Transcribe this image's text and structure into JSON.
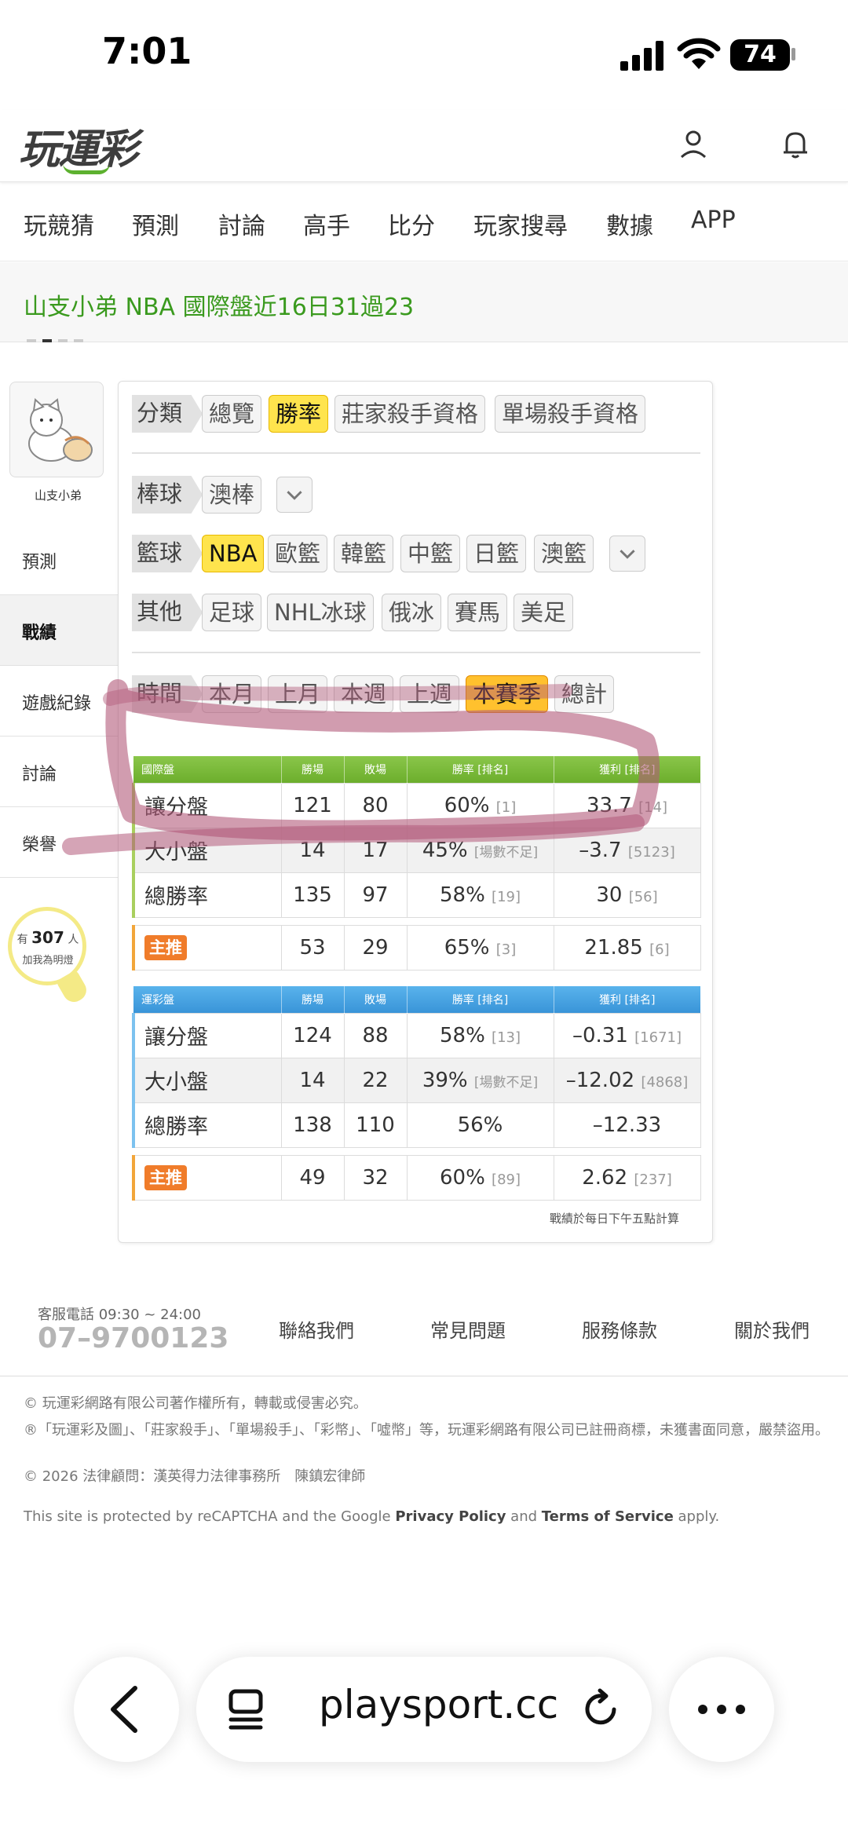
{
  "status_bar": {
    "time": "7:01",
    "battery": "74"
  },
  "header": {
    "logo": "玩運彩"
  },
  "nav": {
    "items": [
      "玩競猜",
      "預測",
      "討論",
      "高手",
      "比分",
      "玩家搜尋",
      "數據",
      "APP"
    ]
  },
  "banner": {
    "title": "山支小弟 NBA 國際盤近16日31過23"
  },
  "sidebar": {
    "profile_name": "山支小弟",
    "items": [
      "預測",
      "戰績",
      "遊戲紀錄",
      "討論",
      "榮譽"
    ],
    "active": "戰績",
    "follower_prefix": "有",
    "follower_count": "307",
    "follower_unit": "人",
    "follower_cta": "加我為明燈"
  },
  "filters": {
    "category_label": "分類",
    "categories": [
      "總覽",
      "勝率",
      "莊家殺手資格",
      "單場殺手資格"
    ],
    "baseball_label": "棒球",
    "baseball": [
      "澳棒"
    ],
    "basketball_label": "籃球",
    "basketball": [
      "NBA",
      "歐籃",
      "韓籃",
      "中籃",
      "日籃",
      "澳籃"
    ],
    "other_label": "其他",
    "other": [
      "足球",
      "NHL冰球",
      "俄冰",
      "賽馬",
      "美足"
    ],
    "time_label": "時間",
    "time": [
      "本月",
      "上月",
      "本週",
      "上週",
      "本賽季",
      "總計"
    ]
  },
  "international_table": {
    "headers": [
      "國際盤",
      "勝場",
      "敗場",
      "勝率 [排名]",
      "獲利 [排名]"
    ],
    "rows": [
      {
        "label": "讓分盤",
        "win": "121",
        "lose": "80",
        "rate": "60%",
        "rate_rank": "[1]",
        "profit": "33.7",
        "profit_rank": "[14]"
      },
      {
        "label": "大小盤",
        "win": "14",
        "lose": "17",
        "rate": "45%",
        "rate_rank": "[場數不足]",
        "profit": "–3.7",
        "profit_rank": "[5123]"
      },
      {
        "label": "總勝率",
        "win": "135",
        "lose": "97",
        "rate": "58%",
        "rate_rank": "[19]",
        "profit": "30",
        "profit_rank": "[56]"
      }
    ],
    "star": {
      "label": "主推",
      "win": "53",
      "lose": "29",
      "rate": "65%",
      "rate_rank": "[3]",
      "profit": "21.85",
      "profit_rank": "[6]"
    }
  },
  "lottery_table": {
    "headers": [
      "運彩盤",
      "勝場",
      "敗場",
      "勝率 [排名]",
      "獲利 [排名]"
    ],
    "rows": [
      {
        "label": "讓分盤",
        "win": "124",
        "lose": "88",
        "rate": "58%",
        "rate_rank": "[13]",
        "profit": "–0.31",
        "profit_rank": "[1671]"
      },
      {
        "label": "大小盤",
        "win": "14",
        "lose": "22",
        "rate": "39%",
        "rate_rank": "[場數不足]",
        "profit": "–12.02",
        "profit_rank": "[4868]"
      },
      {
        "label": "總勝率",
        "win": "138",
        "lose": "110",
        "rate": "56%",
        "rate_rank": "",
        "profit": "–12.33",
        "profit_rank": ""
      }
    ],
    "star": {
      "label": "主推",
      "win": "49",
      "lose": "32",
      "rate": "60%",
      "rate_rank": "[89]",
      "profit": "2.62",
      "profit_rank": "[237]"
    }
  },
  "calc_note": "戰績於每日下午五點計算",
  "footer": {
    "phone_label": "客服電話 09:30 ~ 24:00",
    "phone": "07–9700123",
    "links": [
      "聯絡我們",
      "常見問題",
      "服務條款",
      "關於我們"
    ],
    "copyright": "© 玩運彩網路有限公司著作權所有，轉載或侵害必究。",
    "trademark": "®「玩運彩及圖」、「莊家殺手」、「單場殺手」、「彩幣」、「噓幣」等，玩運彩網路有限公司已註冊商標，未獲書面同意，嚴禁盜用。",
    "legal_counsel": "© 2026 法律顧問：漢英得力法律事務所　陳鎮宏律師",
    "recaptcha_prefix": "This site is protected by reCAPTCHA and the Google",
    "privacy": "Privacy Policy",
    "and": "and",
    "terms": "Terms of Service",
    "apply": "apply."
  },
  "browser": {
    "url": "playsport.cc"
  },
  "colors": {
    "brand_green": "#3a9a1e",
    "active_chip": "#ffe44d",
    "table_green": "#6cae2c",
    "table_blue": "#3994d8",
    "star_orange": "#f07c2a",
    "annotation": "#b25a7a"
  }
}
